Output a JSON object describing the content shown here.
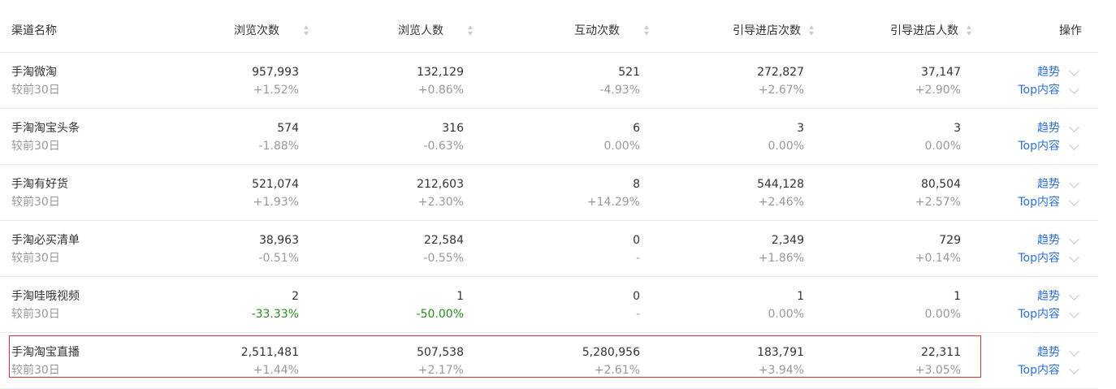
{
  "header": {
    "channel": "渠道名称",
    "views": "浏览次数",
    "visitors": "浏览人数",
    "interactions": "互动次数",
    "guide_visits": "引导进店次数",
    "guide_visitors": "引导进店人数",
    "actions": "操作"
  },
  "rows": [
    {
      "name": "手淘微淘",
      "sub": "较前30日",
      "views": "957,993",
      "views_chg": "+1.52%",
      "visitors": "132,129",
      "visitors_chg": "+0.86%",
      "interactions": "521",
      "interactions_chg": "-4.93%",
      "guide_visits": "272,827",
      "guide_visits_chg": "+2.67%",
      "guide_visitors": "37,147",
      "guide_visitors_chg": "+2.90%",
      "trend": "趋势",
      "top": "Top内容"
    },
    {
      "name": "手淘淘宝头条",
      "sub": "较前30日",
      "views": "574",
      "views_chg": "-1.88%",
      "visitors": "316",
      "visitors_chg": "-0.63%",
      "interactions": "6",
      "interactions_chg": "0.00%",
      "guide_visits": "3",
      "guide_visits_chg": "0.00%",
      "guide_visitors": "3",
      "guide_visitors_chg": "0.00%",
      "trend": "趋势",
      "top": "Top内容"
    },
    {
      "name": "手淘有好货",
      "sub": "较前30日",
      "views": "521,074",
      "views_chg": "+1.93%",
      "visitors": "212,603",
      "visitors_chg": "+2.30%",
      "interactions": "8",
      "interactions_chg": "+14.29%",
      "guide_visits": "544,128",
      "guide_visits_chg": "+2.46%",
      "guide_visitors": "80,504",
      "guide_visitors_chg": "+2.57%",
      "trend": "趋势",
      "top": "Top内容"
    },
    {
      "name": "手淘必买清单",
      "sub": "较前30日",
      "views": "38,963",
      "views_chg": "-0.51%",
      "visitors": "22,584",
      "visitors_chg": "-0.55%",
      "interactions": "0",
      "interactions_chg": "-",
      "guide_visits": "2,349",
      "guide_visits_chg": "+1.86%",
      "guide_visitors": "729",
      "guide_visitors_chg": "+0.14%",
      "trend": "趋势",
      "top": "Top内容"
    },
    {
      "name": "手淘哇哦视频",
      "sub": "较前30日",
      "views": "2",
      "views_chg": "-33.33%",
      "visitors": "1",
      "visitors_chg": "-50.00%",
      "interactions": "0",
      "interactions_chg": "-",
      "guide_visits": "1",
      "guide_visits_chg": "0.00%",
      "guide_visitors": "1",
      "guide_visitors_chg": "0.00%",
      "trend": "趋势",
      "top": "Top内容"
    },
    {
      "name": "手淘淘宝直播",
      "sub": "较前30日",
      "views": "2,511,481",
      "views_chg": "+1.44%",
      "visitors": "507,538",
      "visitors_chg": "+2.17%",
      "interactions": "5,280,956",
      "interactions_chg": "+2.61%",
      "guide_visits": "183,791",
      "guide_visits_chg": "+3.94%",
      "guide_visitors": "22,311",
      "guide_visitors_chg": "+3.05%",
      "trend": "趋势",
      "top": "Top内容"
    }
  ],
  "colors": {
    "link": "#2f6fd6",
    "highlight_border": "#d9333a",
    "negative_green": "#2b8a1e"
  }
}
